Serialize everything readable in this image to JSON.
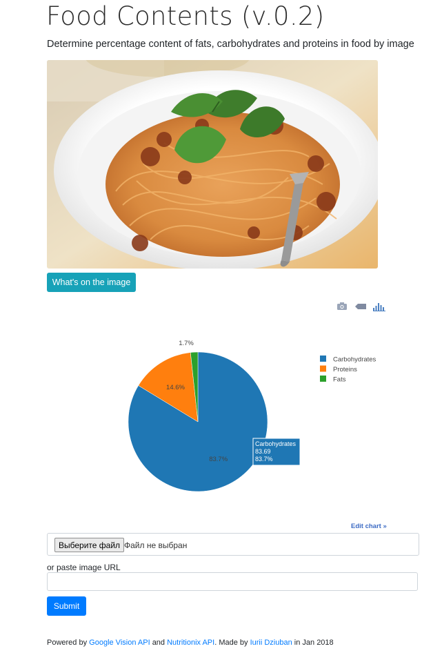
{
  "header": {
    "title": "Food Contents (v.0.2)",
    "subtitle": "Determine percentage content of fats, carbohydrates and proteins in food by image"
  },
  "image": {
    "subject": "spaghetti-bolognese"
  },
  "actions": {
    "whats_on_image_label": "What's on the image"
  },
  "modebar": {
    "icons": [
      "camera-icon",
      "tag-icon",
      "plotly-logo-icon"
    ]
  },
  "chart_data": {
    "type": "pie",
    "slices": [
      {
        "label": "Carbohydrates",
        "value": 83.69,
        "percent_label": "83.7%",
        "color": "#1f77b4"
      },
      {
        "label": "Proteins",
        "value": 14.6,
        "percent_label": "14.6%",
        "color": "#ff7f0e"
      },
      {
        "label": "Fats",
        "value": 1.7,
        "percent_label": "1.7%",
        "color": "#2ca02c"
      }
    ],
    "legend": [
      "Carbohydrates",
      "Proteins",
      "Fats"
    ],
    "legend_placement": "top-right",
    "hover": {
      "label": "Carbohydrates",
      "value": "83.69",
      "percent": "83.7%"
    }
  },
  "edit_chart_label": "Edit chart »",
  "form": {
    "file_button_label": "Выберите файл",
    "file_status": "Файл не выбран",
    "url_label": "or paste image URL",
    "url_value": "",
    "url_placeholder": "",
    "submit_label": "Submit"
  },
  "footer": {
    "powered_by": "Powered by",
    "google_link": "Google Vision API",
    "and": "and",
    "nutritionix_link": "Nutritionix API",
    "made_by": ". Made by",
    "author_link": "Iurii Dziuban",
    "date": "in Jan 2018"
  },
  "colors": {
    "info": "#17a2b8",
    "primary": "#007bff",
    "carbohydrates": "#1f77b4",
    "proteins": "#ff7f0e",
    "fats": "#2ca02c"
  }
}
